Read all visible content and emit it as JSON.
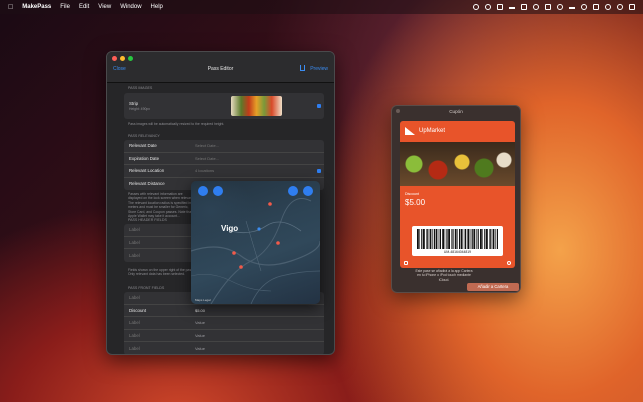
{
  "menubar": {
    "app_name": "MakePass",
    "menus": [
      "File",
      "Edit",
      "View",
      "Window",
      "Help"
    ]
  },
  "editor": {
    "title": "Pass Editor",
    "close_label": "Close",
    "preview_label": "Preview",
    "pass_images": {
      "heading": "PASS IMAGES",
      "strip_label": "Strip",
      "strip_sub": "Height: 490px",
      "note": "Pass images will be automatically resized to the required height."
    },
    "pass_relevancy": {
      "heading": "PASS RELEVANCY",
      "rows": [
        {
          "label": "Relevant Date",
          "value": "Select Date..."
        },
        {
          "label": "Expiration Date",
          "value": "Select Date..."
        },
        {
          "label": "Relevant Location",
          "value": "4 locations"
        },
        {
          "label": "Relevant Distance",
          "value": ""
        }
      ],
      "note": "Passes with relevant information are displayed on the lock screen when relevant. The relevant location radius is specified in meters and must be smaller for Generic, Store Card, and Coupon passes. Note that Apple Wallet may take it account..."
    },
    "header_fields": {
      "heading": "PASS HEADER FIELDS",
      "rows": [
        {
          "label": "Label",
          "value": "Value"
        },
        {
          "label": "Label",
          "value": "Value"
        },
        {
          "label": "Label",
          "value": "Value"
        }
      ],
      "note": "Fields shown on the upper right of the pass. Only relevant data has been selected."
    },
    "front_fields": {
      "heading": "PASS FRONT FIELDS",
      "rows": [
        {
          "label": "Label",
          "value": "Value"
        },
        {
          "label": "Discount",
          "value": "$5.00"
        },
        {
          "label": "Label",
          "value": "Value"
        },
        {
          "label": "Label",
          "value": "Value"
        },
        {
          "label": "Label",
          "value": "Value"
        }
      ]
    }
  },
  "map": {
    "city": "Vigo",
    "legal": "Maps  Legal"
  },
  "coupon": {
    "window_title": "Cupón",
    "brand": "UpMarket",
    "field_label": "Discount",
    "field_value": "$5.00",
    "barcode_text": "UM-48164044819",
    "info_text": "Este pase se añadirá a la app Cartera en tu iPhone o iPod touch mediante iCloud.",
    "add_button": "Añadir a Cartera"
  }
}
